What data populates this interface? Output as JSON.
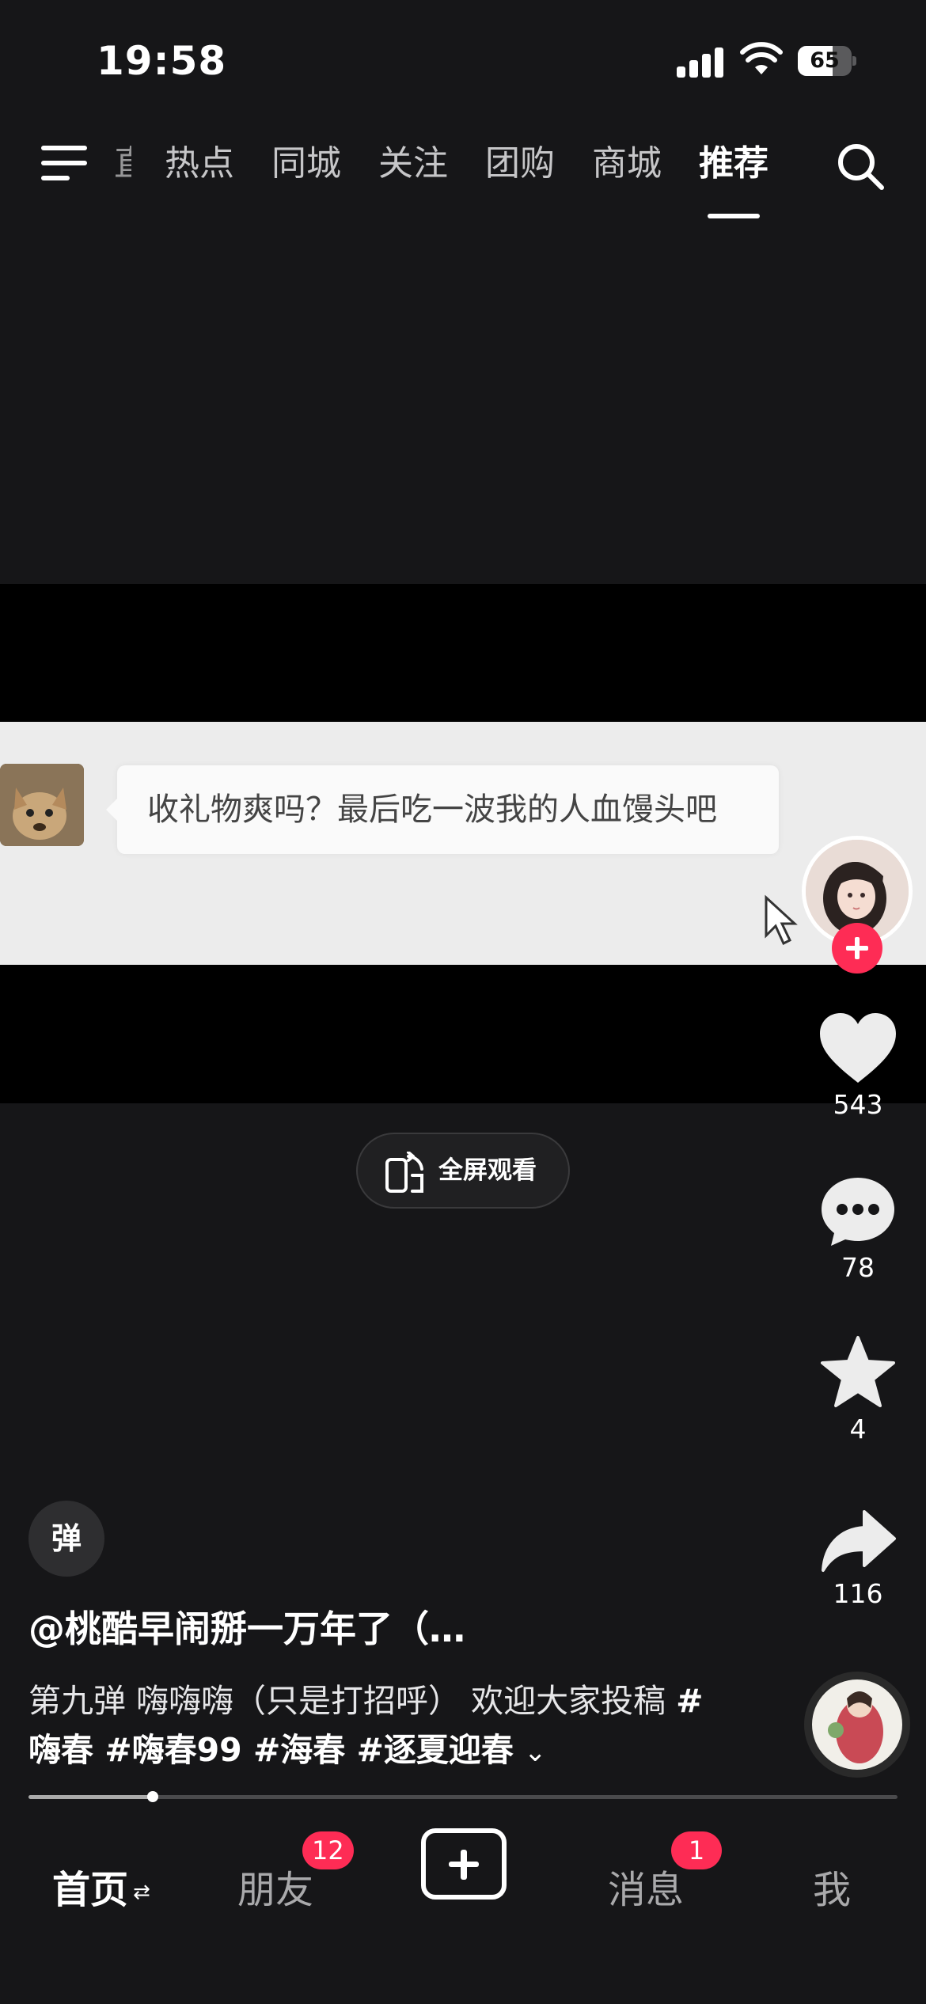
{
  "status_bar": {
    "time": "19:58",
    "battery": "65",
    "battery_level": 0.65
  },
  "top_nav": {
    "tabs": [
      {
        "label": "热点"
      },
      {
        "label": "同城"
      },
      {
        "label": "关注"
      },
      {
        "label": "团购"
      },
      {
        "label": "商城"
      },
      {
        "label": "推荐"
      }
    ],
    "active_tab": "推荐"
  },
  "video": {
    "chat_message": "收礼物爽吗？最后吃一波我的人血馒头吧",
    "fullscreen_label": "全屏观看"
  },
  "actions": {
    "likes": "543",
    "comments": "78",
    "favorites": "4",
    "shares": "116"
  },
  "post": {
    "danmaku_label": "弹",
    "author": "@桃酷早闹掰一万年了（…",
    "description": "第九弹 嗨嗨嗨（只是打招呼） 欢迎大家投稿",
    "hashtags": "#嗨春 #嗨春99 #海春 #逐夏迎春",
    "progress": 0.143
  },
  "bottom_nav": {
    "home": "首页",
    "friends": "朋友",
    "friends_badge": "12",
    "messages": "消息",
    "messages_badge": "1",
    "me": "我"
  },
  "colors": {
    "accent": "#fe2c55",
    "background": "#161618"
  }
}
